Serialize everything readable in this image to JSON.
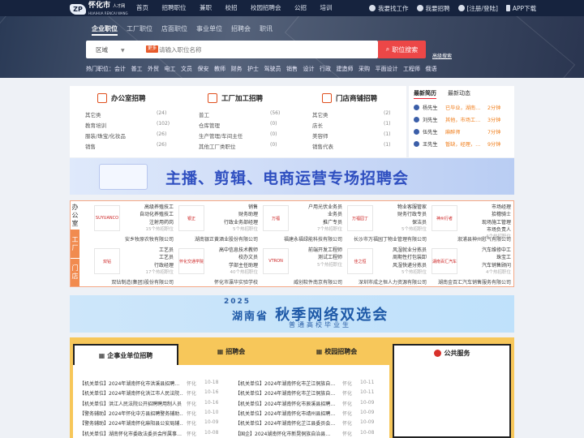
{
  "topbar": {
    "logo_text": "怀化市",
    "logo_sub": "人才网",
    "logo_tag": "HUAIHUA RENCAI WANG",
    "nav": [
      "首页",
      "招聘职位",
      "兼职",
      "校招",
      "校园招聘会",
      "公招",
      "培训"
    ],
    "right": {
      "find_job": "我要找工作",
      "hire": "我要招聘",
      "login": "[注册/登陆]",
      "app": "APP下载"
    }
  },
  "hero": {
    "tabs": [
      "企业职位",
      "工厂职位",
      "店面职位",
      "事业单位",
      "招聘会",
      "职讯"
    ],
    "region_label": "区域",
    "hot_badge": "更多",
    "search_placeholder": "请输入职位名称",
    "search_button": "职位搜索",
    "advanced": "高级搜索",
    "hot_words": [
      "热门职位：会计",
      "普工",
      "外贸",
      "电工",
      "文员",
      "保安",
      "教师",
      "财务",
      "护士",
      "驾驶员",
      "销售",
      "设计",
      "行政",
      "建造师",
      "采购",
      "平面设计",
      "工程师",
      "俄语"
    ]
  },
  "categories": [
    {
      "title": "办公室招聘",
      "items": [
        [
          "其它类",
          "(24)"
        ],
        [
          "教育培训",
          "(102)"
        ],
        [
          "服装/珠宝/化妆品",
          "(26)"
        ],
        [
          "销售",
          "(26)"
        ]
      ]
    },
    {
      "title": "工厂加工招聘",
      "items": [
        [
          "普工",
          "(56)"
        ],
        [
          "仓库管理",
          "(0)"
        ],
        [
          "生产管理/车间主任",
          "(0)"
        ],
        [
          "其他工厂类职位",
          "(0)"
        ]
      ]
    },
    {
      "title": "门店商铺招聘",
      "items": [
        [
          "其它类",
          "(2)"
        ],
        [
          "店长",
          "(1)"
        ],
        [
          "美容师",
          "(1)"
        ],
        [
          "销售代表",
          "(1)"
        ]
      ]
    }
  ],
  "news": {
    "tabs": [
      "最新简历",
      "最新动态"
    ],
    "rows": [
      [
        "杨先生",
        "已毕业，湖南…",
        "2分钟"
      ],
      [
        "刘先生",
        "其他，市场工…",
        "3分钟"
      ],
      [
        "伍先生",
        "麻醉师",
        "7分钟"
      ],
      [
        "王先生",
        "暂缺，经理，…",
        "9分钟"
      ]
    ]
  },
  "banner1": {
    "title": "主播、剪辑、电商运营专场招聘会"
  },
  "famous": {
    "side_labels": [
      "办公室",
      "工厂",
      "门店"
    ],
    "companies": [
      {
        "logo": "SUYUANCO",
        "jobs": [
          "高级养殖技工",
          "自动化养殖技工",
          "注射用药岗"
        ],
        "count": "15个热招职位",
        "name": "安乡牧原农牧有限公司"
      },
      {
        "logo": "银正",
        "jobs": [
          "销售",
          "财务助理",
          "行政业务部经理"
        ],
        "count": "5个热招职位",
        "name": "湖南银正黄酒业股份有限公司"
      },
      {
        "logo": "万福",
        "jobs": [
          "户用光伏业务员",
          "业务员",
          "推广专员"
        ],
        "count": "7个热招职位",
        "name": "福建永福绿能科技有限公司"
      },
      {
        "logo": "万福园丁",
        "jobs": [
          "物业客服管家",
          "财务行政专员",
          "保洁员"
        ],
        "count": "5个热招职位",
        "name": "长沙市万福园丁物业管理有限公司"
      },
      {
        "logo": "神州行者",
        "jobs": [
          "市场经理",
          "拾穗骑士",
          "现场施工管理",
          "市场负责人"
        ],
        "count": "4个热招职位",
        "name": "溆浦县神州慰气有限公司"
      },
      {
        "logo": "双钻",
        "jobs": [
          "工艺员",
          "工艺员",
          "行政经理"
        ],
        "count": "17个热招职位",
        "name": "双钻制造(集团)股份有限公司"
      },
      {
        "logo": "怀化交通学院",
        "jobs": [
          "高中信息技术教师",
          "校办文员",
          "学部主任助理"
        ],
        "count": "40个热招职位",
        "name": "怀化市瀛华实验学校"
      },
      {
        "logo": "VTRON",
        "jobs": [
          "前端开发工程师",
          "测试工程师"
        ],
        "count": "5个热招职位",
        "name": "威创软件南京有限公司"
      },
      {
        "logo": "佳之恒",
        "jobs": [
          "风湿就业分拣员",
          "周期性打包装卸",
          "风湿快递分拣员"
        ],
        "count": "5个热招职位",
        "name": "深圳市成之恒人力资源有限公司"
      },
      {
        "logo": "湖南百汇汽车",
        "jobs": [
          "汽车维修中工",
          "珠宝工",
          "汽车销售顾问"
        ],
        "count": "4个热招职位",
        "name": "湖南金百汇汽车销售服务有限公司"
      }
    ]
  },
  "banner2": {
    "year": "2025",
    "prefix": "湖南省",
    "title": "秋季网络双选会",
    "sub": "普通高校毕业生"
  },
  "bottom": {
    "tabs": [
      "企事业单位招聘",
      "招聘会",
      "校园招聘会"
    ],
    "public_title": "公共服务",
    "left": [
      [
        "【机关单位】2024年湖南怀化市洪溪县招聘…",
        "怀化",
        "10-18"
      ],
      [
        "【机关单位】2024年湖南怀化洪江市人民法院…",
        "怀化",
        "10-16"
      ],
      [
        "【机关单位】洪江人民法院公开招聘聘用制人员",
        "怀化",
        "10-16"
      ],
      [
        "【警务辅助】2024年怀化中方县招聘警务辅助…",
        "怀化",
        "10-10"
      ],
      [
        "【警务辅助】2024年湖南怀化麻阳县公安局辅…",
        "怀化",
        "10-09"
      ],
      [
        "【机关单位】湖南怀化市委政法委员会所属事…",
        "怀化",
        "10-08"
      ]
    ],
    "right": [
      [
        "【机关单位】2024年湖南怀化市芷江侗族自…",
        "怀化",
        "10-11"
      ],
      [
        "【机关单位】2024年湖南怀化市芷江侗族自…",
        "怀化",
        "10-11"
      ],
      [
        "【机关单位】2024年湖南怀化市辰溪县招聘…",
        "怀化",
        "10-09"
      ],
      [
        "【机关单位】2024年湖南怀化市靖州县招聘…",
        "怀化",
        "10-09"
      ],
      [
        "【机关单位】2024年湖南怀化芷江县委员会…",
        "怀化",
        "10-09"
      ],
      [
        "【国企】2024湖南怀化市新晃侗族自治县…",
        "怀化",
        "10-08"
      ]
    ]
  },
  "colors": {
    "accent": "#ec4747",
    "orange": "#f18b4f",
    "topbar": "#16233e"
  }
}
